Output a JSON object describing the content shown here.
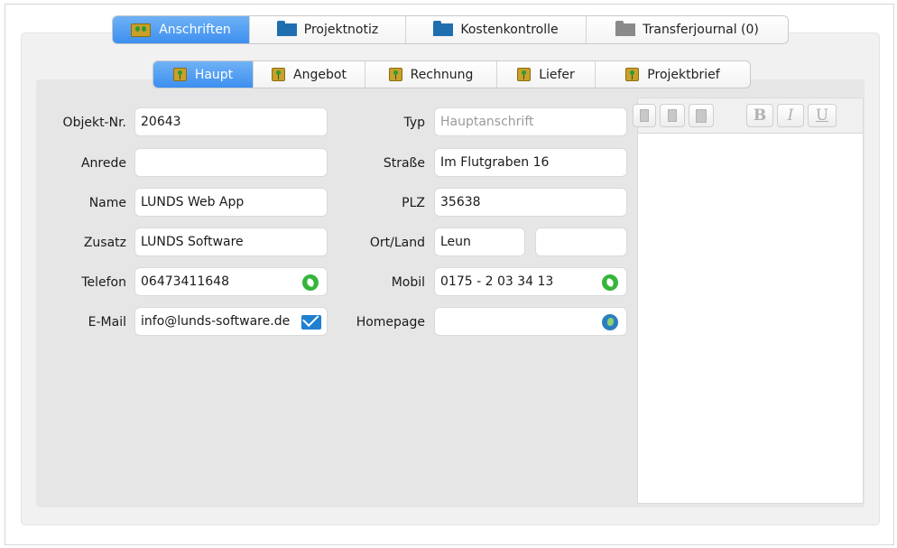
{
  "main_tabs": [
    {
      "label": "Anschriften",
      "icon": "people-icon",
      "active": true
    },
    {
      "label": "Projektnotiz",
      "icon": "folder-icon",
      "active": false
    },
    {
      "label": "Kostenkontrolle",
      "icon": "folder-icon",
      "active": false
    },
    {
      "label": "Transferjournal (0)",
      "icon": "folder-gray-icon",
      "active": false
    }
  ],
  "sub_tabs": [
    {
      "label": "Haupt",
      "active": true
    },
    {
      "label": "Angebot",
      "active": false
    },
    {
      "label": "Rechnung",
      "active": false
    },
    {
      "label": "Liefer",
      "active": false
    },
    {
      "label": "Projektbrief",
      "active": false
    }
  ],
  "form": {
    "objekt_nr": {
      "label": "Objekt-Nr.",
      "value": "20643"
    },
    "anrede": {
      "label": "Anrede",
      "value": ""
    },
    "name": {
      "label": "Name",
      "value": "LUNDS Web App"
    },
    "zusatz": {
      "label": "Zusatz",
      "value": "LUNDS Software"
    },
    "telefon": {
      "label": "Telefon",
      "value": "06473411648"
    },
    "email": {
      "label": "E-Mail",
      "value": "info@lunds-software.de"
    },
    "typ": {
      "label": "Typ",
      "value": "",
      "placeholder": "Hauptanschrift"
    },
    "strasse": {
      "label": "Straße",
      "value": "Im Flutgraben 16"
    },
    "plz": {
      "label": "PLZ",
      "value": "35638"
    },
    "ort_land": {
      "label": "Ort/Land",
      "ort": "Leun",
      "land": ""
    },
    "mobil": {
      "label": "Mobil",
      "value": "0175 - 2 03 34 13"
    },
    "homepage": {
      "label": "Homepage",
      "value": ""
    }
  },
  "editor_toolbar": {
    "bold": "B",
    "italic": "I",
    "underline": "U"
  },
  "colors": {
    "active_tab": "#3d8ff0",
    "phone_green": "#35b53a",
    "mail_blue": "#1f7fd0",
    "globe_blue": "#2a7fc1"
  }
}
